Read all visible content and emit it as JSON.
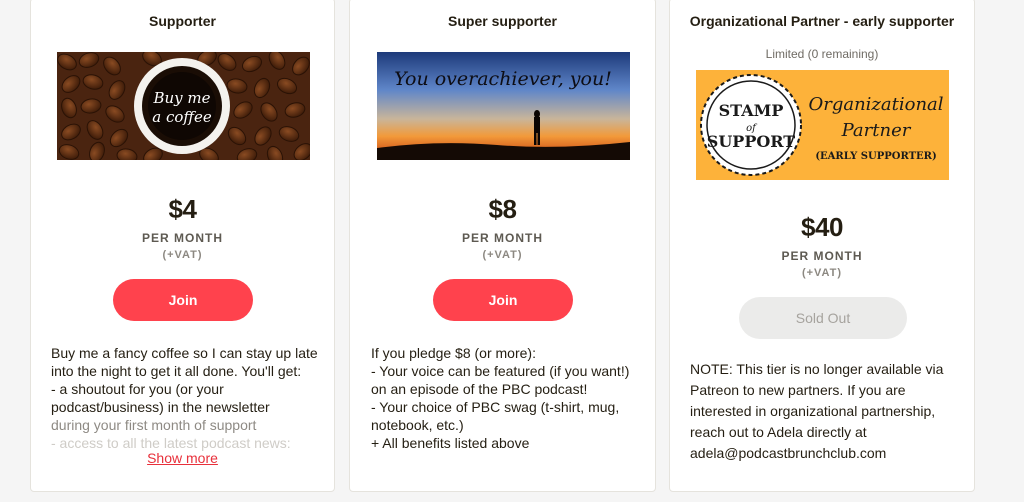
{
  "tiers": [
    {
      "title": "Supporter",
      "banner_text": [
        "Buy me",
        "a coffee"
      ],
      "price": "$4",
      "period": "PER MONTH",
      "vat": "(+VAT)",
      "button_label": "Join",
      "description_lines": [
        "Buy me a fancy coffee so I can stay up late",
        "into the night to get it all done. You'll get:",
        "- a shoutout for you (or your",
        "podcast/business) in the newsletter",
        "during your first month of support",
        "- access to all the latest podcast news:"
      ],
      "show_more_label": "Show more"
    },
    {
      "title": "Super supporter",
      "banner_text": "You overachiever, you!",
      "price": "$8",
      "period": "PER MONTH",
      "vat": "(+VAT)",
      "button_label": "Join",
      "description_lines": [
        "If you pledge $8 (or more):",
        "- Your voice can be featured (if you want!)",
        "on an episode of the PBC podcast!",
        "- Your choice of PBC swag (t-shirt, mug,",
        "notebook, etc.)",
        "+ All benefits listed above"
      ]
    },
    {
      "title": "Organizational Partner - early supporter",
      "limited": "Limited (0 remaining)",
      "banner_stamp": [
        "STAMP",
        "of",
        "SUPPORT"
      ],
      "banner_text": [
        "Organizational",
        "Partner",
        "(EARLY SUPPORTER)"
      ],
      "price": "$40",
      "period": "PER MONTH",
      "vat": "(+VAT)",
      "button_label": "Sold Out",
      "description_lines": [
        "NOTE: This tier is no longer available via",
        "Patreon to new partners. If you are",
        "interested in organizational partnership,",
        "reach out to Adela directly at",
        "adela@podcastbrunchclub.com"
      ]
    }
  ],
  "colors": {
    "join_button": "#ff424d",
    "sold_out_button": "#ebebea",
    "show_more_link": "#e8303b",
    "banner_orange": "#fdb23a"
  }
}
